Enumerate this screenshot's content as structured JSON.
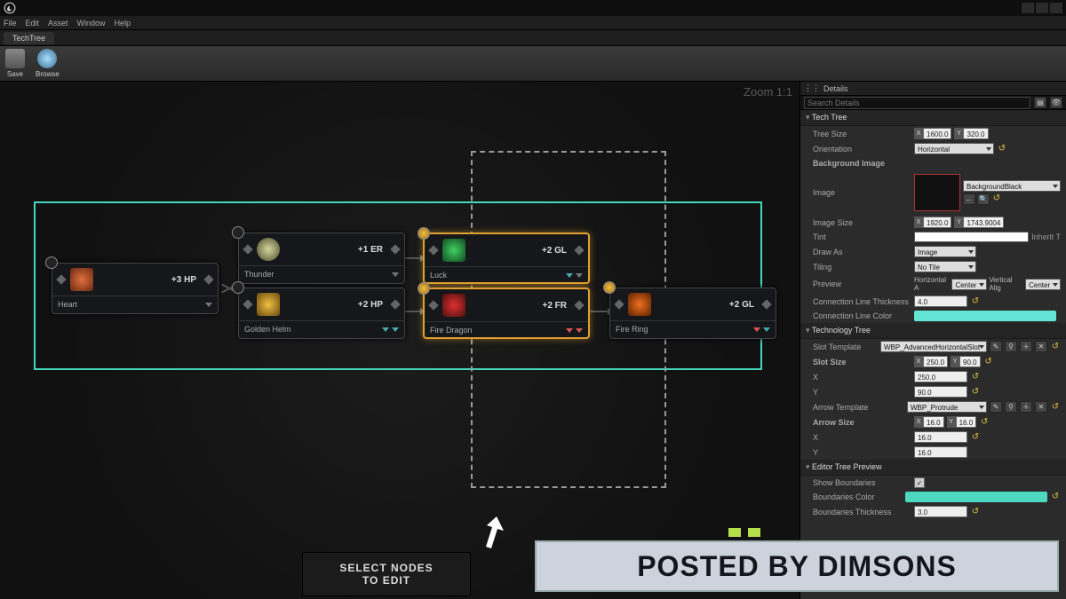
{
  "titlebar": {
    "title": ""
  },
  "menu": {
    "file": "File",
    "edit": "Edit",
    "asset": "Asset",
    "window": "Window",
    "help": "Help"
  },
  "tab": {
    "name": "TechTree"
  },
  "toolbar": {
    "save": "Save",
    "browse": "Browse"
  },
  "graph": {
    "zoom": "Zoom  1:1",
    "hint1": "SELECT NODES",
    "hint2": "TO EDIT",
    "nodes": {
      "heart": {
        "name": "Heart",
        "stat": "+3 HP"
      },
      "thunder": {
        "name": "Thunder",
        "stat": "+1 ER"
      },
      "golden": {
        "name": "Golden Helm",
        "stat": "+2 HP"
      },
      "luck": {
        "name": "Luck",
        "stat": "+2 GL"
      },
      "firedragon": {
        "name": "Fire Dragon",
        "stat": "+2 FR"
      },
      "firering": {
        "name": "Fire Ring",
        "stat": "+2 GL"
      }
    }
  },
  "details": {
    "title": "Details",
    "search_ph": "Search Details",
    "cat_techtree": "Tech Tree",
    "tree_size": {
      "lbl": "Tree Size",
      "x": "1600.0",
      "y": "320.0"
    },
    "orientation": {
      "lbl": "Orientation",
      "val": "Horizontal"
    },
    "bg_image": {
      "lbl": "Background Image"
    },
    "image": {
      "lbl": "Image",
      "asset": "BackgroundBlack"
    },
    "image_size": {
      "lbl": "Image Size",
      "x": "1920.0",
      "y": "1743.9004"
    },
    "tint": {
      "lbl": "Tint"
    },
    "drawas": {
      "lbl": "Draw As",
      "val": "Image"
    },
    "tiling": {
      "lbl": "Tiling",
      "val": "No Tile"
    },
    "preview": {
      "lbl": "Preview",
      "h": "Horizontal A",
      "hc": "Center",
      "v": "Vertical Alig",
      "vc": "Center"
    },
    "conn_thick": {
      "lbl": "Connection Line Thickness",
      "val": "4.0"
    },
    "conn_color": {
      "lbl": "Connection Line Color"
    },
    "cat_techtree2": "Technology Tree",
    "slot_template": {
      "lbl": "Slot Template",
      "val": "WBP_AdvancedHorizontalSlot"
    },
    "slot_size": {
      "lbl": "Slot Size",
      "x": "250.0",
      "y": "90.0"
    },
    "sx": {
      "lbl": "X",
      "val": "250.0"
    },
    "sy": {
      "lbl": "Y",
      "val": "90.0"
    },
    "arrow_template": {
      "lbl": "Arrow Template",
      "val": "WBP_Protrude"
    },
    "arrow_size": {
      "lbl": "Arrow Size",
      "x": "16.0",
      "y": "16.0"
    },
    "ax": {
      "lbl": "X",
      "val": "16.0"
    },
    "ay": {
      "lbl": "Y",
      "val": "16.0"
    },
    "cat_editor": "Editor Tree Preview",
    "show_bound": {
      "lbl": "Show Boundaries"
    },
    "bound_color": {
      "lbl": "Boundaries Color"
    },
    "bound_thick": {
      "lbl": "Boundaries Thickness",
      "val": "3.0"
    },
    "inherit": "Inherit T"
  },
  "overlay": {
    "text": "POSTED BY DIMSONS"
  }
}
